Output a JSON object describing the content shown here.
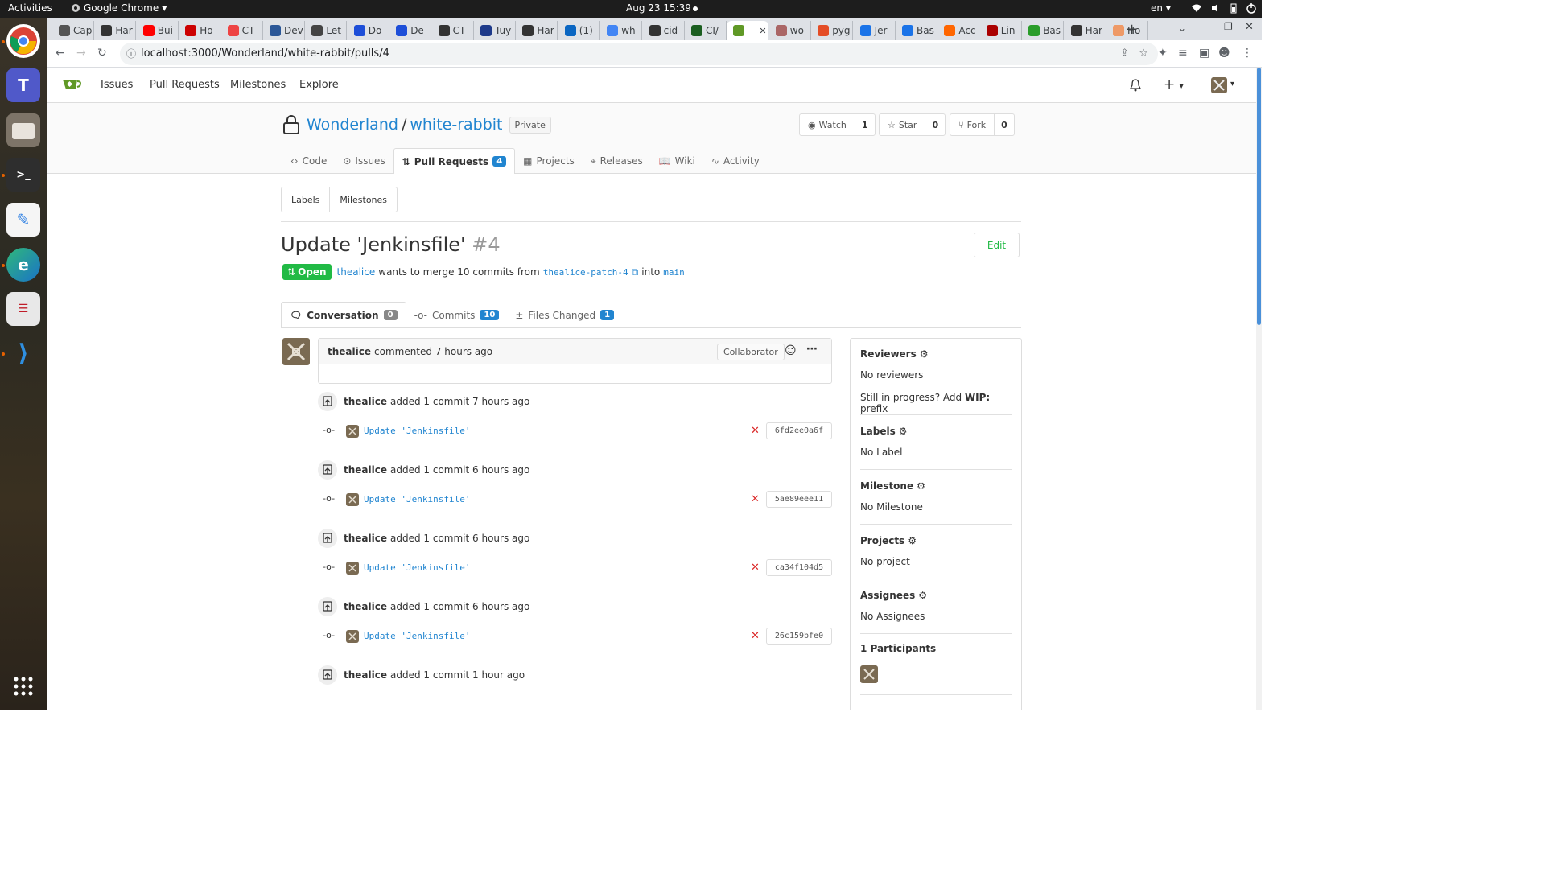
{
  "system_bar": {
    "activities": "Activities",
    "app_name": "Google Chrome",
    "clock": "Aug 23  15:39",
    "lang": "en"
  },
  "tabs": [
    "Cap",
    "Har",
    "Bui",
    "Ho",
    "CT",
    "Dev",
    "Let",
    "Do",
    "De",
    "CT",
    "Tuy",
    "Har",
    "(1)",
    "wh",
    "cid",
    "CI/",
    "",
    "wo",
    "pyg",
    "Jer",
    "Bas",
    "Acc",
    "Lin",
    "Bas",
    "Har",
    "Ho"
  ],
  "address_bar": {
    "url": "localhost:3000/Wonderland/white-rabbit/pulls/4"
  },
  "nav": {
    "issues": "Issues",
    "pull_requests": "Pull Requests",
    "milestones": "Milestones",
    "explore": "Explore"
  },
  "repo": {
    "owner": "Wonderland",
    "separator": "/",
    "name": "white-rabbit",
    "visibility": "Private",
    "watch_label": "Watch",
    "watch_count": "1",
    "star_label": "Star",
    "star_count": "0",
    "fork_label": "Fork",
    "fork_count": "0"
  },
  "repo_tabs": [
    {
      "label": "Code"
    },
    {
      "label": "Issues"
    },
    {
      "label": "Pull Requests",
      "count": "4"
    },
    {
      "label": "Projects"
    },
    {
      "label": "Releases"
    },
    {
      "label": "Wiki"
    },
    {
      "label": "Activity"
    }
  ],
  "filters": {
    "labels": "Labels",
    "milestones": "Milestones"
  },
  "pr": {
    "title": "Update 'Jenkinsfile'",
    "number": "#4",
    "edit": "Edit",
    "status": "Open",
    "author": "thealice",
    "merge_text": "wants to merge 10 commits from",
    "head_branch": "thealice-patch-4",
    "into": "into",
    "base_branch": "main"
  },
  "pr_tabs": [
    {
      "label": "Conversation",
      "count": "0"
    },
    {
      "label": "Commits",
      "count": "10"
    },
    {
      "label": "Files Changed",
      "count": "1"
    }
  ],
  "comment": {
    "author": "thealice",
    "action": "commented 7 hours ago",
    "role": "Collaborator"
  },
  "events": [
    {
      "author": "thealice",
      "text": "added 1 commit 7 hours ago",
      "commit_msg": "Update 'Jenkinsfile'",
      "sha": "6fd2ee0a6f"
    },
    {
      "author": "thealice",
      "text": "added 1 commit 6 hours ago",
      "commit_msg": "Update 'Jenkinsfile'",
      "sha": "5ae89eee11"
    },
    {
      "author": "thealice",
      "text": "added 1 commit 6 hours ago",
      "commit_msg": "Update 'Jenkinsfile'",
      "sha": "ca34f104d5"
    },
    {
      "author": "thealice",
      "text": "added 1 commit 6 hours ago",
      "commit_msg": "Update 'Jenkinsfile'",
      "sha": "26c159bfe0"
    },
    {
      "author": "thealice",
      "text": "added 1 commit 1 hour ago"
    }
  ],
  "sidebar": {
    "reviewers": {
      "title": "Reviewers",
      "value": "No reviewers",
      "wip_pre": "Still in progress? Add ",
      "wip_bold": "WIP:",
      "wip_post": " prefix"
    },
    "labels": {
      "title": "Labels",
      "value": "No Label"
    },
    "milestone": {
      "title": "Milestone",
      "value": "No Milestone"
    },
    "projects": {
      "title": "Projects",
      "value": "No project"
    },
    "assignees": {
      "title": "Assignees",
      "value": "No Assignees"
    },
    "participants": {
      "title": "1 Participants"
    }
  },
  "colors": {
    "accent": "#2185d0",
    "open_green": "#21ba45",
    "fail_red": "#db2828"
  }
}
